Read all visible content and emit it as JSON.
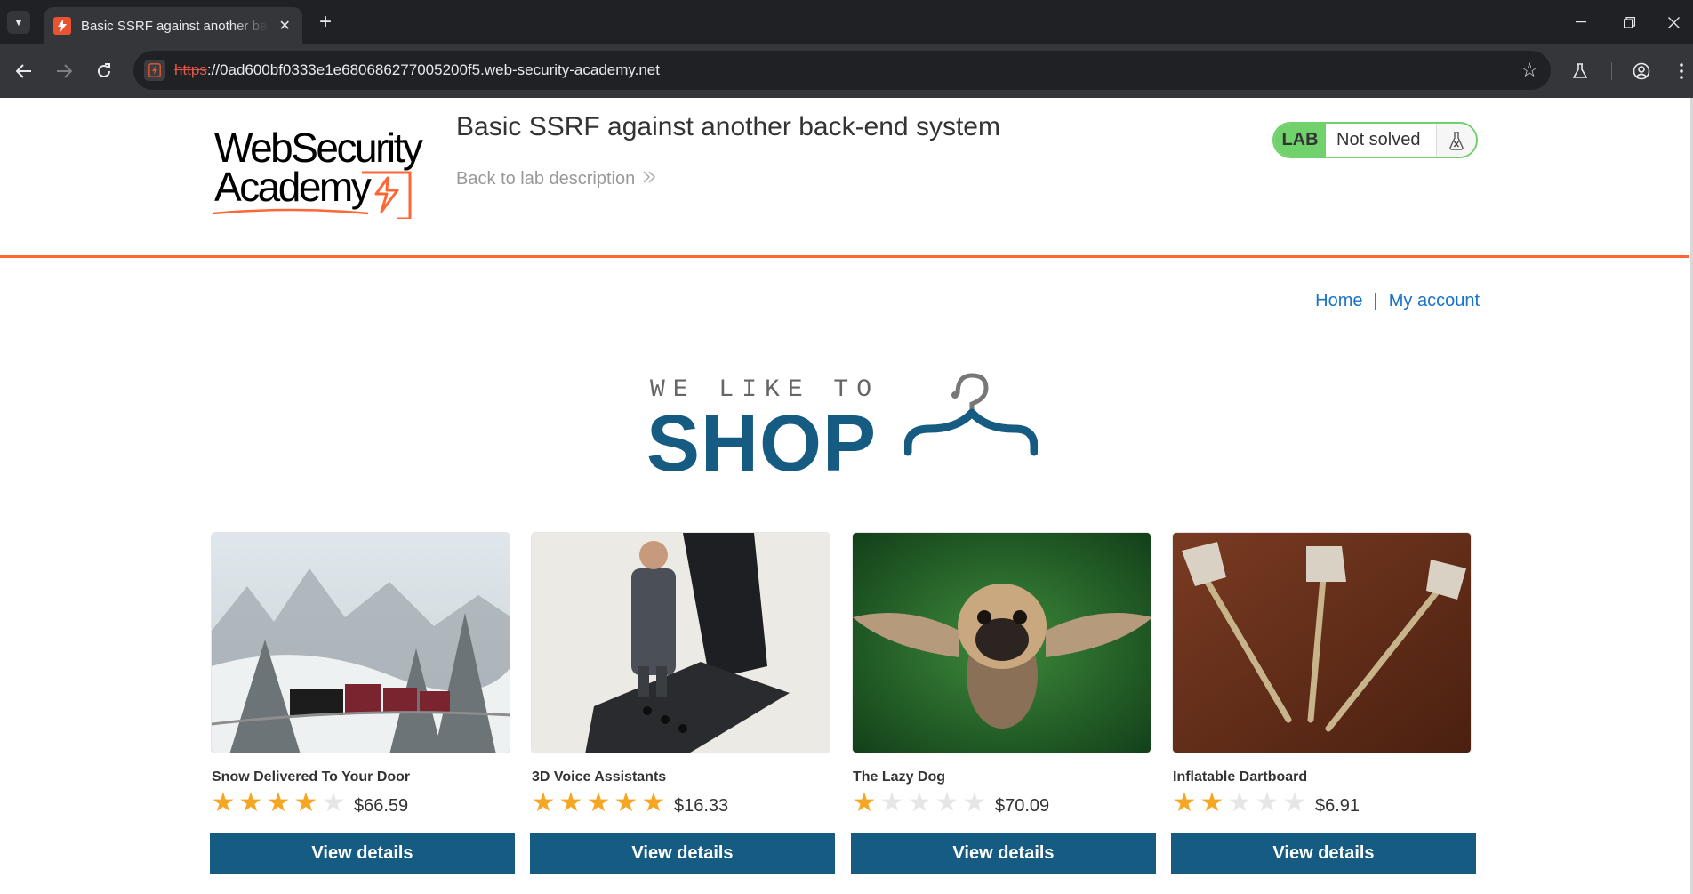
{
  "browser": {
    "tab_title": "Basic SSRF against another back-end system",
    "url_scheme": "https",
    "url_rest": "://0ad600bf0333e1e680686277005200f5.web-security-academy.net",
    "accent_color": "#e8542f"
  },
  "lab_header": {
    "logo_line1": "WebSecurity",
    "logo_line2": "Academy",
    "title": "Basic SSRF against another back-end system",
    "back_link": "Back to lab description",
    "status_badge": "LAB",
    "status_text": "Not solved",
    "status_color": "#70d16d",
    "accent_line_color": "#ff6633"
  },
  "nav": {
    "home": "Home",
    "separator": "|",
    "account": "My account",
    "link_color": "#1a73c7"
  },
  "banner": {
    "tagline": "WE LIKE TO",
    "word": "SHOP",
    "icon": "hanger-icon",
    "brand_color": "#165b82"
  },
  "products": [
    {
      "name": "Snow Delivered To Your Door",
      "rating": 4,
      "price": "$66.59",
      "button": "View details",
      "image": "snow-train-image"
    },
    {
      "name": "3D Voice Assistants",
      "rating": 5,
      "price": "$16.33",
      "button": "View details",
      "image": "figurine-phone-image"
    },
    {
      "name": "The Lazy Dog",
      "rating": 1,
      "price": "$70.09",
      "button": "View details",
      "image": "flying-pug-image"
    },
    {
      "name": "Inflatable Dartboard",
      "rating": 2,
      "price": "$6.91",
      "button": "View details",
      "image": "darts-image"
    }
  ],
  "rating_max": 5,
  "star_color": "#f5a623"
}
